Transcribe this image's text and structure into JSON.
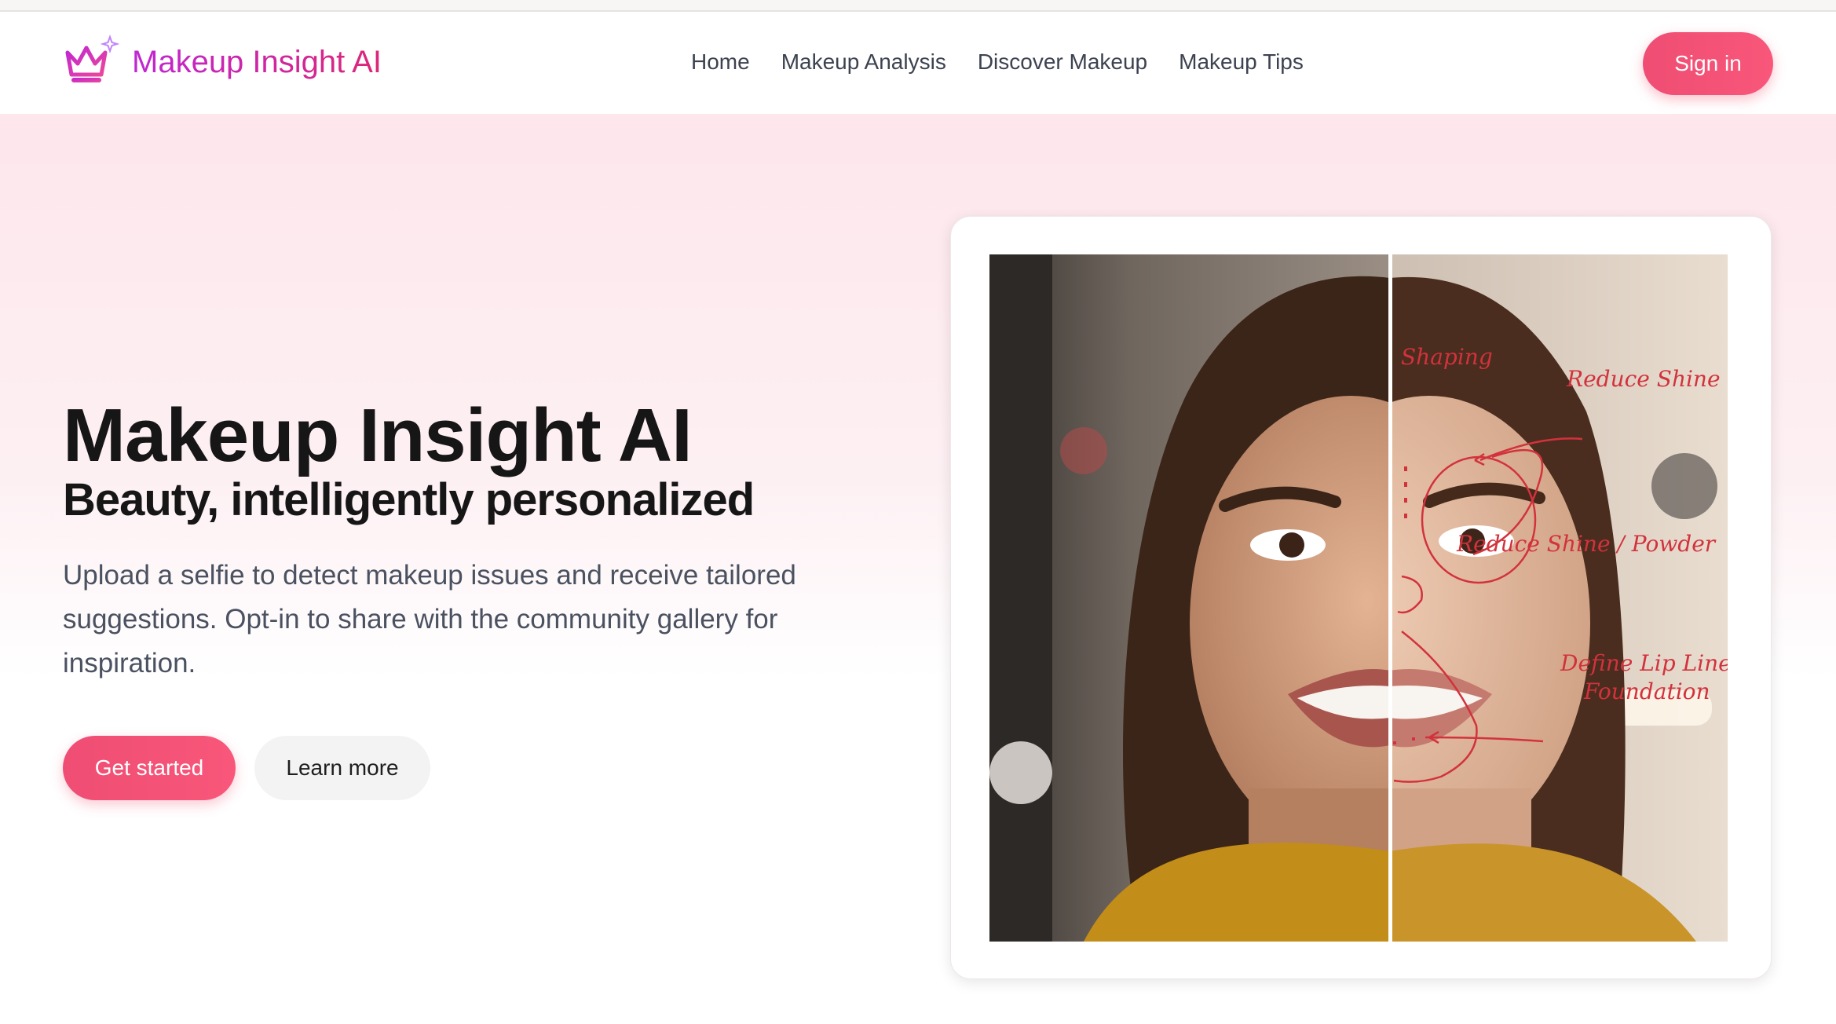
{
  "header": {
    "brand_name": "Makeup Insight AI",
    "nav": [
      "Home",
      "Makeup Analysis",
      "Discover Makeup",
      "Makeup Tips"
    ],
    "sign_in_label": "Sign in"
  },
  "hero": {
    "title": "Makeup Insight AI",
    "subtitle": "Beauty, intelligently personalized",
    "description": "Upload a selfie to detect makeup issues and receive tailored suggestions. Opt-in to share with the community gallery for inspiration.",
    "primary_cta": "Get started",
    "secondary_cta": "Learn more"
  },
  "image_annotations": {
    "shaping": "Shaping",
    "reduce_shine": "Reduce Shine",
    "reduce_shine_powder": "Reduce Shine / Powder",
    "define_lip_line": "Define Lip Line",
    "foundation": "Foundation"
  },
  "colors": {
    "brand_gradient_start": "#c026d3",
    "brand_gradient_end": "#db2777",
    "accent": "#f0506e",
    "annotation_red": "#d2323c"
  },
  "icons": {
    "logo": "crown-sparkle-icon"
  }
}
